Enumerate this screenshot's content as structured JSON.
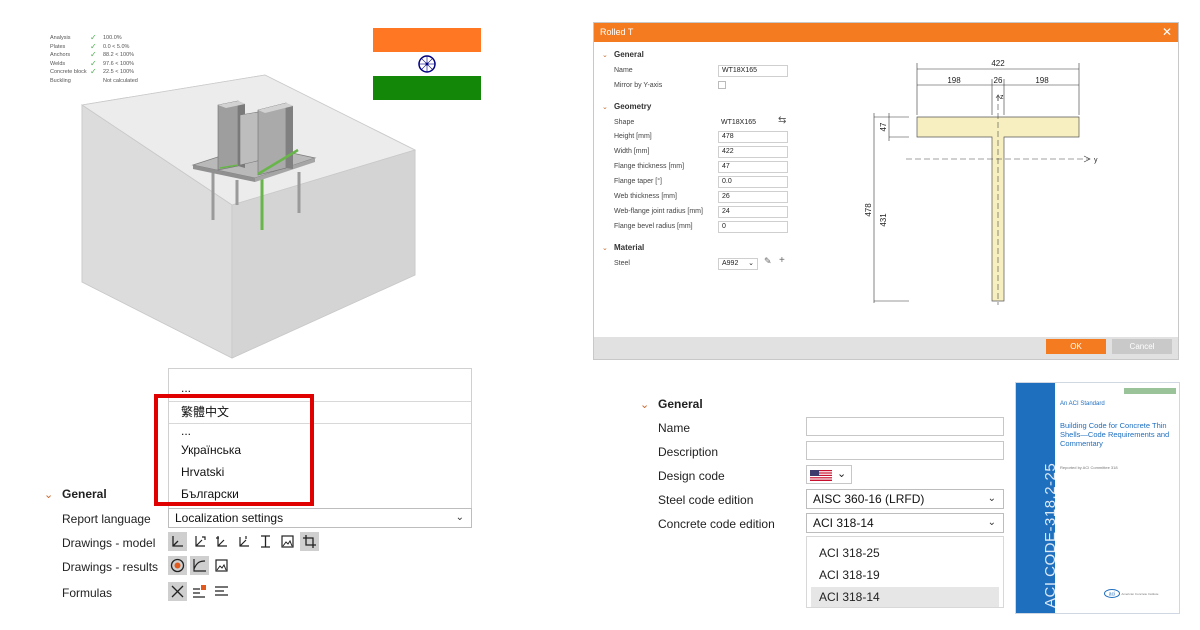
{
  "checks": [
    {
      "label": "Analysis",
      "ok": true,
      "value": "100.0%"
    },
    {
      "label": "Plates",
      "ok": true,
      "value": "0.0 < 5.0%"
    },
    {
      "label": "Anchors",
      "ok": true,
      "value": "88.2 < 100%"
    },
    {
      "label": "Welds",
      "ok": true,
      "value": "97.6 < 100%"
    },
    {
      "label": "Concrete block",
      "ok": true,
      "value": "22.5 < 100%"
    },
    {
      "label": "Buckling",
      "ok": false,
      "value": "Not calculated"
    }
  ],
  "flag": {
    "top": "#ff7722",
    "middle": "#ffffff",
    "bottom": "#138808",
    "chakra": "#000080"
  },
  "language_list": {
    "items": [
      "...",
      "繁體中文",
      "...",
      "Українська",
      "Hrvatski",
      "Български"
    ]
  },
  "left_general": {
    "title": "General",
    "report_language_label": "Report language",
    "report_language_value": "Localization settings",
    "drawings_model_label": "Drawings - model",
    "drawings_results_label": "Drawings - results",
    "formulas_label": "Formulas"
  },
  "dialog": {
    "title": "Rolled T",
    "close": "✕",
    "general": {
      "title": "General",
      "name_label": "Name",
      "name_value": "WT18X165",
      "mirror_label": "Mirror by Y-axis"
    },
    "geometry": {
      "title": "Geometry",
      "shape_label": "Shape",
      "shape_value": "WT18X165",
      "fields": [
        {
          "label": "Height [mm]",
          "value": "478"
        },
        {
          "label": "Width [mm]",
          "value": "422"
        },
        {
          "label": "Flange thickness [mm]",
          "value": "47"
        },
        {
          "label": "Flange taper [°]",
          "value": "0.0"
        },
        {
          "label": "Web thickness [mm]",
          "value": "26"
        },
        {
          "label": "Web-flange joint radius [mm]",
          "value": "24"
        },
        {
          "label": "Flange bevel radius [mm]",
          "value": "0"
        }
      ]
    },
    "material": {
      "title": "Material",
      "steel_label": "Steel",
      "steel_value": "A992"
    },
    "drawing": {
      "width": "422",
      "left": "198",
      "web": "26",
      "right": "198",
      "flange": "47",
      "height": "478",
      "web_height": "431",
      "y_axis": "y",
      "z_axis": "z"
    },
    "ok": "OK",
    "cancel": "Cancel"
  },
  "right_general": {
    "title": "General",
    "name_label": "Name",
    "description_label": "Description",
    "design_code_label": "Design code",
    "steel_code_label": "Steel code edition",
    "steel_code_value": "AISC 360-16 (LRFD)",
    "concrete_code_label": "Concrete code edition",
    "concrete_code_value": "ACI 318-14",
    "concrete_options": [
      "ACI 318-25",
      "ACI 318-19",
      "ACI 318-14"
    ]
  },
  "book": {
    "standard": "An ACI Standard",
    "title": "Building Code for Concrete Thin Shells—Code Requirements and Commentary",
    "byline": "Reported by ACI Committee 318",
    "spine": "ACI CODE-318.2-25",
    "logo": "aci"
  }
}
